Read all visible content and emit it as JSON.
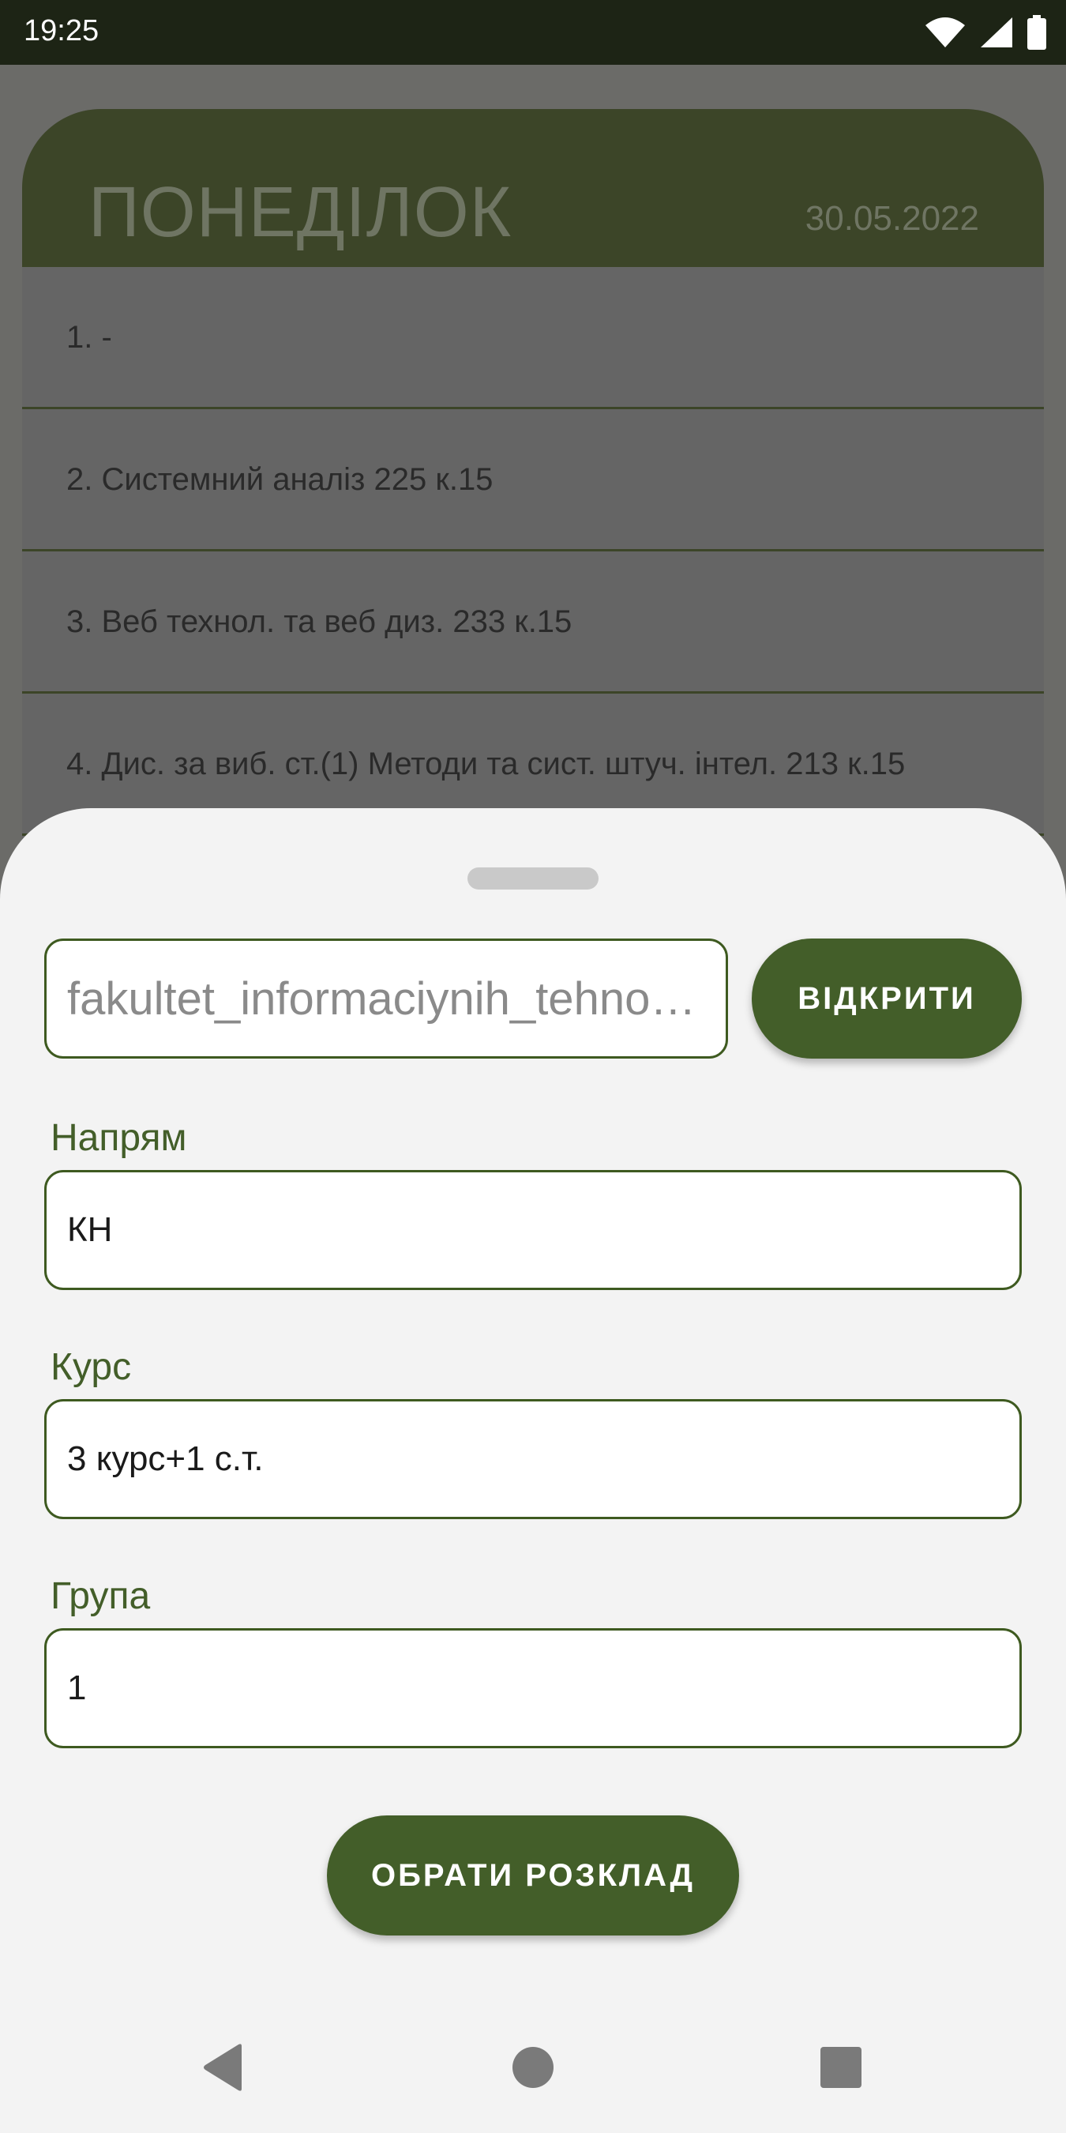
{
  "status_bar": {
    "time": "19:25",
    "icons": [
      "wifi-icon",
      "cell-signal-icon",
      "battery-icon"
    ]
  },
  "day_card": {
    "title": "ПОНЕДІЛОК",
    "date": "30.05.2022",
    "lessons": [
      "1.  -",
      "2. Системний аналіз  225 к.15",
      "3. Веб технол. та веб диз.  233 к.15",
      "4. Дис. за виб. ст.(1) Методи та сист. штуч. інтел.  213 к.15"
    ]
  },
  "sheet": {
    "url_value": "fakultet_informaciynih_tehnologiy",
    "open_label": "ВІДКРИТИ",
    "direction_label": "Напрям",
    "direction_value": "КН",
    "course_label": "Курс",
    "course_value": "3 курс+1 с.т.",
    "group_label": "Група",
    "group_value": "1",
    "select_label": "ОБРАТИ РОЗКЛАД"
  },
  "nav_bar": {
    "icons": [
      "back-icon",
      "home-icon",
      "recents-icon"
    ]
  },
  "colors": {
    "accent": "#435e29",
    "status_bar": "#1d2415",
    "sheet_bg": "#f3f3f3",
    "scrim": "#6b6b68"
  }
}
